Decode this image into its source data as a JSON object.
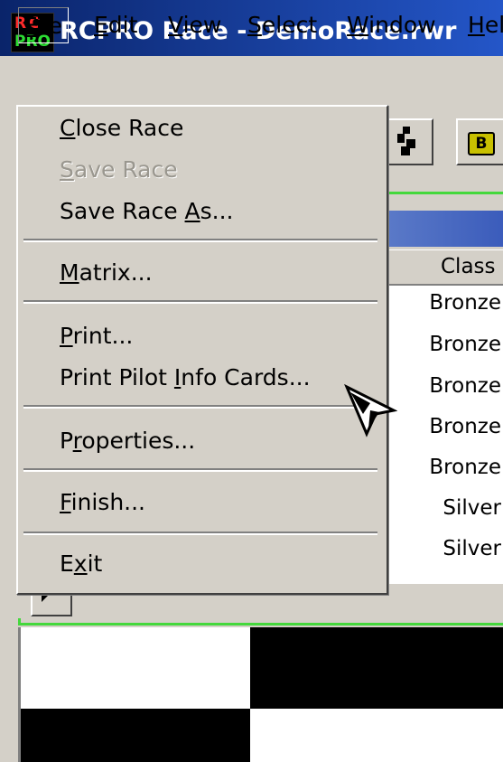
{
  "window": {
    "logo_top": "RC",
    "logo_bottom": "PRO",
    "title": "RCPRO Race - DemoRace.rwr"
  },
  "menubar": {
    "items": [
      {
        "pre": "",
        "key": "F",
        "post": "ile"
      },
      {
        "pre": "",
        "key": "E",
        "post": "dit"
      },
      {
        "pre": "",
        "key": "V",
        "post": "iew"
      },
      {
        "pre": "",
        "key": "S",
        "post": "elect"
      },
      {
        "pre": "",
        "key": "W",
        "post": "indow"
      },
      {
        "pre": "",
        "key": "H",
        "post": "el"
      }
    ]
  },
  "file_menu": {
    "items": [
      {
        "pre": "",
        "key": "C",
        "post": "lose Race",
        "enabled": true
      },
      {
        "pre": "",
        "key": "S",
        "post": "ave Race",
        "enabled": false
      },
      {
        "pre": "Save Race ",
        "key": "A",
        "post": "s...",
        "enabled": true
      },
      {
        "pre": "",
        "key": "M",
        "post": "atrix...",
        "enabled": true
      },
      {
        "pre": "",
        "key": "P",
        "post": "rint...",
        "enabled": true
      },
      {
        "pre": "Print Pilot ",
        "key": "I",
        "post": "nfo Cards...",
        "enabled": true
      },
      {
        "pre": "P",
        "key": "r",
        "post": "operties...",
        "enabled": true
      },
      {
        "pre": "",
        "key": "F",
        "post": "inish...",
        "enabled": true
      },
      {
        "pre": "E",
        "key": "x",
        "post": "it",
        "enabled": true
      }
    ]
  },
  "toolbar": {
    "b_icon": "B"
  },
  "table": {
    "class_header": "Class",
    "class_values": [
      "Bronze",
      "Bronze",
      "Bronze",
      "Bronze",
      "Bronze",
      "Silver",
      "Silver"
    ]
  },
  "colors": {
    "titlebar_start": "#0a246a",
    "titlebar_end": "#2456c8",
    "frame_border": "#44d83c",
    "face": "#d4d0c8"
  }
}
